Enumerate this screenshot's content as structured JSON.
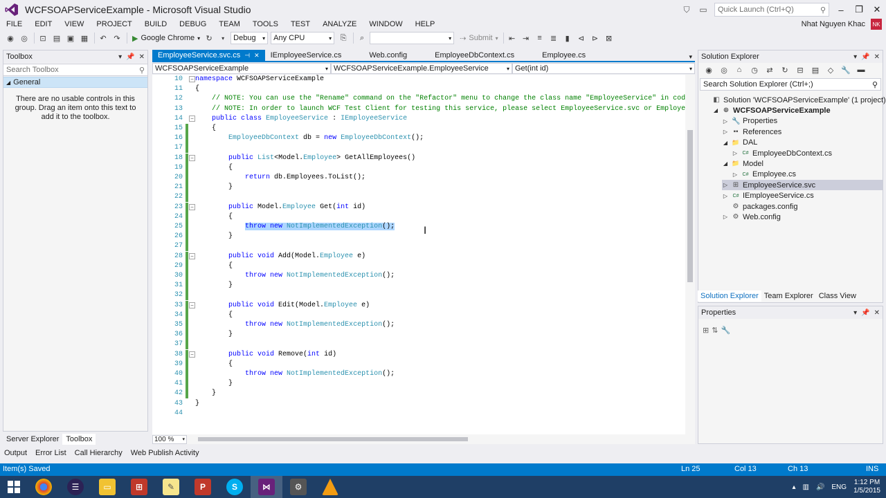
{
  "window": {
    "title": "WCFSOAPServiceExample - Microsoft Visual Studio",
    "quick_launch_placeholder": "Quick Launch (Ctrl+Q)"
  },
  "menu": [
    "FILE",
    "EDIT",
    "VIEW",
    "PROJECT",
    "BUILD",
    "DEBUG",
    "TEAM",
    "TOOLS",
    "TEST",
    "ANALYZE",
    "WINDOW",
    "HELP"
  ],
  "user": {
    "name": "Nhat Nguyen Khac",
    "initials": "NK"
  },
  "toolbar": {
    "browser": "Google Chrome",
    "config": "Debug",
    "platform": "Any CPU",
    "submit": "Submit"
  },
  "toolbox": {
    "title": "Toolbox",
    "search_placeholder": "Search Toolbox",
    "group": "General",
    "message": "There are no usable controls in this group. Drag an item onto this text to add it to the toolbox."
  },
  "left_tabs": [
    "Server Explorer",
    "Toolbox"
  ],
  "output_tabs": [
    "Output",
    "Error List",
    "Call Hierarchy",
    "Web Publish Activity"
  ],
  "doc_tabs": [
    {
      "label": "EmployeeService.svc.cs",
      "active": true
    },
    {
      "label": "IEmployeeService.cs"
    },
    {
      "label": "Web.config"
    },
    {
      "label": "EmployeeDbContext.cs"
    },
    {
      "label": "Employee.cs"
    }
  ],
  "nav": {
    "project": "WCFSOAPServiceExample",
    "type": "WCFSOAPServiceExample.EmployeeService",
    "member": "Get(int id)"
  },
  "code_lines": [
    {
      "n": "10",
      "fold": "-",
      "chg": "",
      "html": "<span class=\"kw\">namespace</span> WCFSOAPServiceExample"
    },
    {
      "n": "11",
      "fold": "",
      "chg": "",
      "html": "{"
    },
    {
      "n": "12",
      "fold": "",
      "chg": "",
      "html": "    <span class=\"cm\">// NOTE: You can use the \"Rename\" command on the \"Refactor\" menu to change the class name \"EmployeeService\" in code, svc and</span>"
    },
    {
      "n": "13",
      "fold": "",
      "chg": "",
      "html": "    <span class=\"cm\">// NOTE: In order to launch WCF Test Client for testing this service, please select EmployeeService.svc or EmployeeService.svc.cs</span>"
    },
    {
      "n": "14",
      "fold": "-",
      "chg": "",
      "html": "    <span class=\"kw\">public class</span> <span class=\"ty\">EmployeeService</span> : <span class=\"ty\">IEmployeeService</span>"
    },
    {
      "n": "15",
      "fold": "",
      "chg": "g",
      "html": "    {"
    },
    {
      "n": "16",
      "fold": "",
      "chg": "g",
      "html": "        <span class=\"ty\">EmployeeDbContext</span> db = <span class=\"kw\">new</span> <span class=\"ty\">EmployeeDbContext</span>();"
    },
    {
      "n": "17",
      "fold": "",
      "chg": "g",
      "html": ""
    },
    {
      "n": "18",
      "fold": "-",
      "chg": "g",
      "html": "        <span class=\"kw\">public</span> <span class=\"ty\">List</span>&lt;Model.<span class=\"ty\">Employee</span>&gt; GetAllEmployees()"
    },
    {
      "n": "19",
      "fold": "",
      "chg": "g",
      "html": "        {"
    },
    {
      "n": "20",
      "fold": "",
      "chg": "g",
      "html": "            <span class=\"kw\">return</span> db.Employees.ToList();"
    },
    {
      "n": "21",
      "fold": "",
      "chg": "g",
      "html": "        }"
    },
    {
      "n": "22",
      "fold": "",
      "chg": "g",
      "html": ""
    },
    {
      "n": "23",
      "fold": "-",
      "chg": "g",
      "html": "        <span class=\"kw\">public</span> Model.<span class=\"ty\">Employee</span> Get(<span class=\"kw\">int</span> id)"
    },
    {
      "n": "24",
      "fold": "",
      "chg": "g",
      "html": "        {"
    },
    {
      "n": "25",
      "fold": "",
      "chg": "g",
      "html": "            <span class=\"sel\"><span class=\"kw\">throw new</span> <span class=\"ty\">NotImplementedException</span>();</span>"
    },
    {
      "n": "26",
      "fold": "",
      "chg": "g",
      "html": "        }"
    },
    {
      "n": "27",
      "fold": "",
      "chg": "g",
      "html": ""
    },
    {
      "n": "28",
      "fold": "-",
      "chg": "g",
      "html": "        <span class=\"kw\">public void</span> Add(Model.<span class=\"ty\">Employee</span> e)"
    },
    {
      "n": "29",
      "fold": "",
      "chg": "g",
      "html": "        {"
    },
    {
      "n": "30",
      "fold": "",
      "chg": "g",
      "html": "            <span class=\"kw\">throw new</span> <span class=\"ty\">NotImplementedException</span>();"
    },
    {
      "n": "31",
      "fold": "",
      "chg": "g",
      "html": "        }"
    },
    {
      "n": "32",
      "fold": "",
      "chg": "g",
      "html": ""
    },
    {
      "n": "33",
      "fold": "-",
      "chg": "g",
      "html": "        <span class=\"kw\">public void</span> Edit(Model.<span class=\"ty\">Employee</span> e)"
    },
    {
      "n": "34",
      "fold": "",
      "chg": "g",
      "html": "        {"
    },
    {
      "n": "35",
      "fold": "",
      "chg": "g",
      "html": "            <span class=\"kw\">throw new</span> <span class=\"ty\">NotImplementedException</span>();"
    },
    {
      "n": "36",
      "fold": "",
      "chg": "g",
      "html": "        }"
    },
    {
      "n": "37",
      "fold": "",
      "chg": "g",
      "html": ""
    },
    {
      "n": "38",
      "fold": "-",
      "chg": "g",
      "html": "        <span class=\"kw\">public void</span> Remove(<span class=\"kw\">int</span> id)"
    },
    {
      "n": "39",
      "fold": "",
      "chg": "g",
      "html": "        {"
    },
    {
      "n": "40",
      "fold": "",
      "chg": "g",
      "html": "            <span class=\"kw\">throw new</span> <span class=\"ty\">NotImplementedException</span>();"
    },
    {
      "n": "41",
      "fold": "",
      "chg": "g",
      "html": "        }"
    },
    {
      "n": "42",
      "fold": "",
      "chg": "g",
      "html": "    }"
    },
    {
      "n": "43",
      "fold": "",
      "chg": "",
      "html": "}"
    },
    {
      "n": "44",
      "fold": "",
      "chg": "",
      "html": ""
    }
  ],
  "zoom": "100 %",
  "solution_explorer": {
    "title": "Solution Explorer",
    "search_placeholder": "Search Solution Explorer (Ctrl+;)",
    "items": [
      {
        "label": "Solution 'WCFSOAPServiceExample' (1 project)",
        "indent": 0,
        "arrow": "",
        "icon": "solution-icon",
        "glyph": "◧"
      },
      {
        "label": "WCFSOAPServiceExample",
        "indent": 1,
        "arrow": "◢",
        "icon": "web-project-icon",
        "glyph": "⊕",
        "bold": true
      },
      {
        "label": "Properties",
        "indent": 2,
        "arrow": "▷",
        "icon": "wrench-icon",
        "glyph": "🔧"
      },
      {
        "label": "References",
        "indent": 2,
        "arrow": "▷",
        "icon": "references-icon",
        "glyph": "▪▪"
      },
      {
        "label": "DAL",
        "indent": 2,
        "arrow": "◢",
        "icon": "folder-icon",
        "glyph": "📁"
      },
      {
        "label": "EmployeeDbContext.cs",
        "indent": 3,
        "arrow": "▷",
        "icon": "csharp-file-icon",
        "glyph": "C#"
      },
      {
        "label": "Model",
        "indent": 2,
        "arrow": "◢",
        "icon": "folder-icon",
        "glyph": "📁"
      },
      {
        "label": "Employee.cs",
        "indent": 3,
        "arrow": "▷",
        "icon": "csharp-file-icon",
        "glyph": "C#"
      },
      {
        "label": "EmployeeService.svc",
        "indent": 2,
        "arrow": "▷",
        "icon": "svc-file-icon",
        "glyph": "⊞",
        "selected": true
      },
      {
        "label": "IEmployeeService.cs",
        "indent": 2,
        "arrow": "▷",
        "icon": "csharp-file-icon",
        "glyph": "C#"
      },
      {
        "label": "packages.config",
        "indent": 2,
        "arrow": "",
        "icon": "config-file-icon",
        "glyph": "⚙"
      },
      {
        "label": "Web.config",
        "indent": 2,
        "arrow": "▷",
        "icon": "config-file-icon",
        "glyph": "⚙"
      }
    ]
  },
  "sol_tabs": [
    "Solution Explorer",
    "Team Explorer",
    "Class View"
  ],
  "properties": {
    "title": "Properties"
  },
  "status": {
    "message": "Item(s) Saved",
    "ln": "Ln 25",
    "col": "Col 13",
    "ch": "Ch 13",
    "mode": "INS"
  },
  "tray": {
    "lang": "ENG",
    "time": "1:12 PM",
    "date": "1/5/2015"
  },
  "colors": {
    "accent": "#007acc",
    "taskbar": "#1f3f66"
  }
}
